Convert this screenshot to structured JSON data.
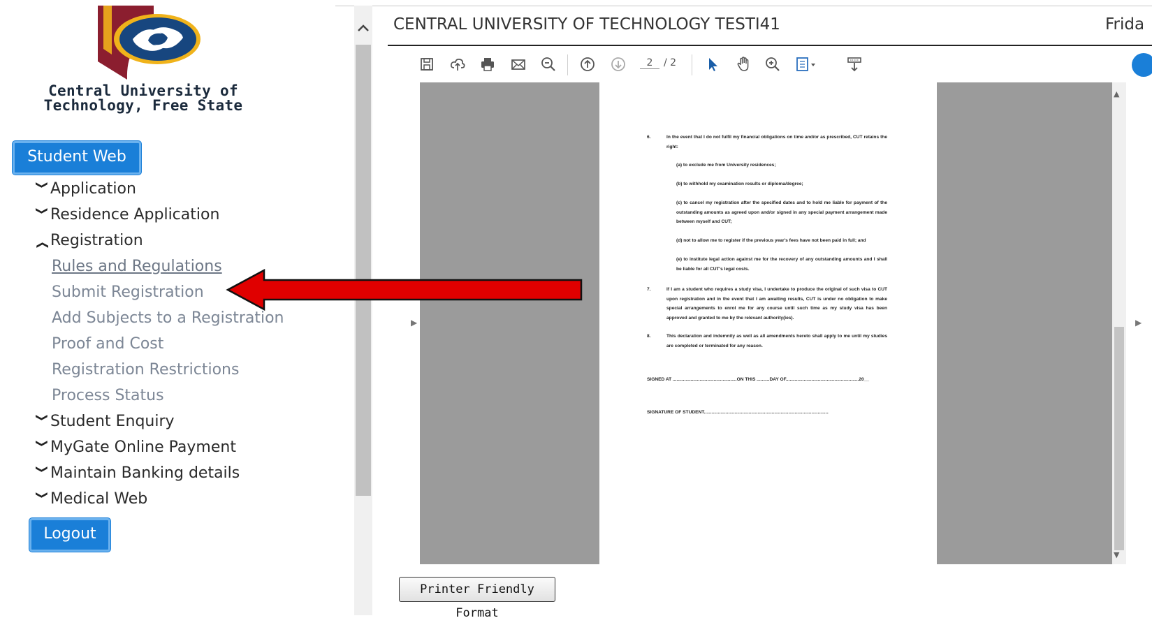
{
  "sidebar": {
    "logo_line1": "Central University of",
    "logo_line2": "Technology, Free State",
    "student_web_button": "Student Web",
    "nav": [
      {
        "label": "Application",
        "expanded": false
      },
      {
        "label": "Residence Application",
        "expanded": false
      },
      {
        "label": "Registration",
        "expanded": true
      },
      {
        "label": "Student Enquiry",
        "expanded": false
      },
      {
        "label": "MyGate Online Payment",
        "expanded": false
      },
      {
        "label": "Maintain Banking details",
        "expanded": false
      },
      {
        "label": "Medical Web",
        "expanded": false
      }
    ],
    "registration_links": [
      "Rules and Regulations",
      "Submit Registration",
      "Add Subjects to a Registration",
      "Proof and Cost",
      "Registration Restrictions",
      "Process Status"
    ],
    "logout_button": "Logout",
    "chevron_down": "⌄",
    "chevron_up": "^"
  },
  "header": {
    "title": "CENTRAL UNIVERSITY OF TECHNOLOGY TESTI41",
    "day": "Frida"
  },
  "pdf_toolbar": {
    "current_page": "2",
    "total_pages": "/ 2",
    "icons": [
      "save-icon",
      "upload-icon",
      "print-icon",
      "mail-icon",
      "zoom-out-icon",
      "page-up-icon",
      "page-down-icon",
      "select-cursor-icon",
      "hand-icon",
      "zoom-in-icon",
      "fit-page-icon",
      "download-icon"
    ]
  },
  "document": {
    "item6_num": "6.",
    "item6_text": "In the event that I do not fulfil my financial obligations on time and/or as prescribed, CUT retains the right:",
    "item6_a": "(a)  to exclude me from University residences;",
    "item6_b": "(b)  to withhold my examination results or diploma/degree;",
    "item6_c": "(c)  to cancel my registration after the specified dates and to hold me liable for payment of the outstanding amounts as agreed upon and/or signed in any special payment arrangement made between myself and CUT;",
    "item6_d": "(d)  not to allow me to register if the previous year's fees have not been paid in full; and",
    "item6_e": "(e)  to institute legal action against me for the recovery of any outstanding amounts and I shall be liable for all CUT's legal costs.",
    "item7_num": "7.",
    "item7_text": "If I am a student who requires a study visa, I undertake to produce the original of such visa to CUT upon registration and in the event that I am awaiting results, CUT is under no obligation to make special arrangements to enrol me for any course until such time as my study visa has been approved and granted to me by the relevant authority(ies).",
    "item8_num": "8.",
    "item8_text": "This declaration and indemnity as well as all amendments hereto shall apply to me until my studies are completed or terminated for any reason.",
    "signed_line": "SIGNED AT ..................................................ON THIS ..........DAY OF.........................................................20__",
    "signature_line": "SIGNATURE OF STUDENT........................................................................................................"
  },
  "printer_button": "Printer Friendly Format",
  "colors": {
    "accent_blue": "#1a7fd8",
    "arrow_red": "#e00000",
    "link_gray": "#7c8695"
  }
}
